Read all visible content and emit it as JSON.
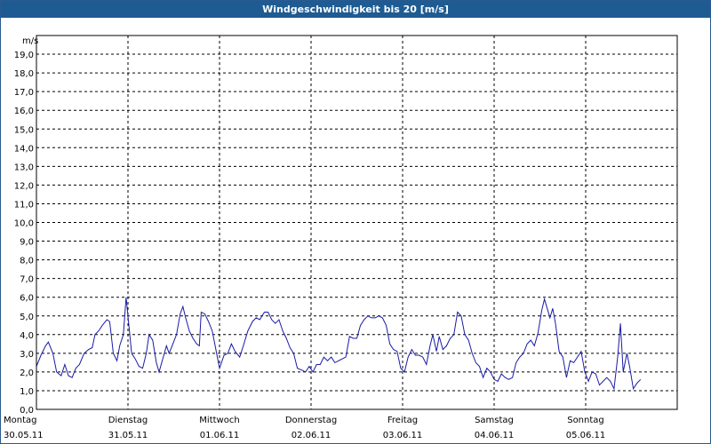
{
  "window": {
    "title": "Windgeschwindigkeit bis 20 [m/s]"
  },
  "colors": {
    "titlebar": "#1e5b93",
    "series": "#1a1aa6",
    "grid": "#000000"
  },
  "chart_data": {
    "type": "line",
    "title": "Windgeschwindigkeit bis 20 [m/s]",
    "ylabel": "m/s",
    "ylim": [
      0,
      20
    ],
    "yticks": [
      "0,0",
      "1,0",
      "2,0",
      "3,0",
      "4,0",
      "5,0",
      "6,0",
      "7,0",
      "8,0",
      "9,0",
      "10,0",
      "11,0",
      "12,0",
      "13,0",
      "14,0",
      "15,0",
      "16,0",
      "17,0",
      "18,0",
      "19,0"
    ],
    "xlim": [
      0,
      7
    ],
    "day_labels": [
      {
        "day": "Montag",
        "date": "30.05.11"
      },
      {
        "day": "Dienstag",
        "date": "31.05.11"
      },
      {
        "day": "Mittwoch",
        "date": "01.06.11"
      },
      {
        "day": "Donnerstag",
        "date": "02.06.11"
      },
      {
        "day": "Freitag",
        "date": "03.06.11"
      },
      {
        "day": "Samstag",
        "date": "04.06.11"
      },
      {
        "day": "Sonntag",
        "date": "05.06.11"
      }
    ],
    "grid": true,
    "series": [
      {
        "values": [
          [
            0.0,
            2.3
          ],
          [
            0.05,
            2.9
          ],
          [
            0.1,
            3.4
          ],
          [
            0.13,
            3.6
          ],
          [
            0.18,
            3.0
          ],
          [
            0.22,
            2.0
          ],
          [
            0.27,
            1.8
          ],
          [
            0.31,
            2.4
          ],
          [
            0.35,
            1.8
          ],
          [
            0.39,
            1.7
          ],
          [
            0.43,
            2.2
          ],
          [
            0.47,
            2.4
          ],
          [
            0.52,
            3.0
          ],
          [
            0.57,
            3.2
          ],
          [
            0.61,
            3.3
          ],
          [
            0.64,
            4.0
          ],
          [
            0.68,
            4.2
          ],
          [
            0.72,
            4.5
          ],
          [
            0.77,
            4.8
          ],
          [
            0.8,
            4.7
          ],
          [
            0.84,
            3.0
          ],
          [
            0.88,
            2.6
          ],
          [
            0.91,
            3.4
          ],
          [
            0.95,
            4.0
          ],
          [
            0.98,
            6.0
          ],
          [
            1.01,
            4.5
          ],
          [
            1.04,
            3.0
          ],
          [
            1.08,
            2.7
          ],
          [
            1.12,
            2.3
          ],
          [
            1.16,
            2.2
          ],
          [
            1.2,
            3.0
          ],
          [
            1.23,
            4.0
          ],
          [
            1.27,
            3.7
          ],
          [
            1.31,
            2.5
          ],
          [
            1.34,
            2.0
          ],
          [
            1.38,
            2.7
          ],
          [
            1.42,
            3.4
          ],
          [
            1.45,
            3.0
          ],
          [
            1.49,
            3.5
          ],
          [
            1.53,
            4.0
          ],
          [
            1.57,
            5.1
          ],
          [
            1.6,
            5.5
          ],
          [
            1.63,
            4.9
          ],
          [
            1.67,
            4.2
          ],
          [
            1.71,
            3.8
          ],
          [
            1.75,
            3.5
          ],
          [
            1.78,
            3.4
          ],
          [
            1.8,
            5.2
          ],
          [
            1.84,
            5.1
          ],
          [
            1.88,
            4.7
          ],
          [
            1.92,
            4.2
          ],
          [
            1.96,
            3.2
          ],
          [
            2.0,
            2.2
          ],
          [
            2.05,
            2.9
          ],
          [
            2.09,
            3.0
          ],
          [
            2.13,
            3.5
          ],
          [
            2.17,
            3.1
          ],
          [
            2.22,
            2.8
          ],
          [
            2.26,
            3.4
          ],
          [
            2.31,
            4.2
          ],
          [
            2.36,
            4.7
          ],
          [
            2.4,
            4.9
          ],
          [
            2.44,
            4.8
          ],
          [
            2.49,
            5.2
          ],
          [
            2.53,
            5.2
          ],
          [
            2.57,
            4.8
          ],
          [
            2.61,
            4.6
          ],
          [
            2.65,
            4.8
          ],
          [
            2.69,
            4.2
          ],
          [
            2.73,
            3.8
          ],
          [
            2.77,
            3.3
          ],
          [
            2.81,
            3.0
          ],
          [
            2.85,
            2.2
          ],
          [
            2.9,
            2.1
          ],
          [
            2.94,
            2.0
          ],
          [
            2.98,
            2.3
          ],
          [
            3.02,
            2.0
          ],
          [
            3.06,
            2.4
          ],
          [
            3.1,
            2.4
          ],
          [
            3.14,
            2.8
          ],
          [
            3.18,
            2.6
          ],
          [
            3.22,
            2.8
          ],
          [
            3.26,
            2.5
          ],
          [
            3.3,
            2.6
          ],
          [
            3.34,
            2.7
          ],
          [
            3.38,
            2.8
          ],
          [
            3.42,
            3.9
          ],
          [
            3.46,
            3.8
          ],
          [
            3.5,
            3.8
          ],
          [
            3.54,
            4.5
          ],
          [
            3.58,
            4.8
          ],
          [
            3.62,
            5.0
          ],
          [
            3.66,
            4.9
          ],
          [
            3.7,
            4.9
          ],
          [
            3.74,
            5.0
          ],
          [
            3.78,
            4.9
          ],
          [
            3.82,
            4.5
          ],
          [
            3.86,
            3.5
          ],
          [
            3.9,
            3.2
          ],
          [
            3.94,
            3.1
          ],
          [
            3.98,
            2.2
          ],
          [
            4.02,
            2.0
          ],
          [
            4.06,
            2.8
          ],
          [
            4.1,
            3.2
          ],
          [
            4.14,
            2.9
          ],
          [
            4.18,
            2.9
          ],
          [
            4.22,
            2.8
          ],
          [
            4.26,
            2.4
          ],
          [
            4.3,
            3.4
          ],
          [
            4.33,
            4.0
          ],
          [
            4.37,
            3.1
          ],
          [
            4.4,
            3.9
          ],
          [
            4.44,
            3.2
          ],
          [
            4.48,
            3.4
          ],
          [
            4.52,
            3.8
          ],
          [
            4.56,
            4.0
          ],
          [
            4.6,
            5.2
          ],
          [
            4.64,
            5.0
          ],
          [
            4.68,
            4.0
          ],
          [
            4.72,
            3.7
          ],
          [
            4.76,
            3.0
          ],
          [
            4.8,
            2.5
          ],
          [
            4.84,
            2.3
          ],
          [
            4.88,
            1.7
          ],
          [
            4.92,
            2.2
          ],
          [
            4.96,
            2.0
          ],
          [
            5.0,
            1.6
          ],
          [
            5.04,
            1.5
          ],
          [
            5.08,
            1.9
          ],
          [
            5.12,
            1.7
          ],
          [
            5.16,
            1.6
          ],
          [
            5.2,
            1.7
          ],
          [
            5.24,
            2.5
          ],
          [
            5.28,
            2.8
          ],
          [
            5.32,
            3.0
          ],
          [
            5.36,
            3.5
          ],
          [
            5.4,
            3.7
          ],
          [
            5.44,
            3.4
          ],
          [
            5.48,
            4.1
          ],
          [
            5.52,
            5.3
          ],
          [
            5.55,
            5.9
          ],
          [
            5.58,
            5.4
          ],
          [
            5.61,
            4.9
          ],
          [
            5.64,
            5.4
          ],
          [
            5.67,
            4.6
          ],
          [
            5.71,
            3.1
          ],
          [
            5.75,
            2.8
          ],
          [
            5.79,
            1.7
          ],
          [
            5.83,
            2.6
          ],
          [
            5.87,
            2.5
          ],
          [
            5.91,
            2.8
          ],
          [
            5.95,
            3.1
          ],
          [
            5.99,
            2.0
          ],
          [
            6.03,
            1.5
          ],
          [
            6.07,
            2.0
          ],
          [
            6.11,
            1.9
          ],
          [
            6.15,
            1.3
          ],
          [
            6.19,
            1.5
          ],
          [
            6.23,
            1.7
          ],
          [
            6.27,
            1.5
          ],
          [
            6.31,
            1.1
          ],
          [
            6.35,
            2.8
          ],
          [
            6.38,
            4.6
          ],
          [
            6.41,
            2.0
          ],
          [
            6.45,
            3.0
          ],
          [
            6.48,
            2.3
          ],
          [
            6.52,
            1.1
          ],
          [
            6.56,
            1.4
          ],
          [
            6.6,
            1.6
          ]
        ]
      }
    ]
  }
}
